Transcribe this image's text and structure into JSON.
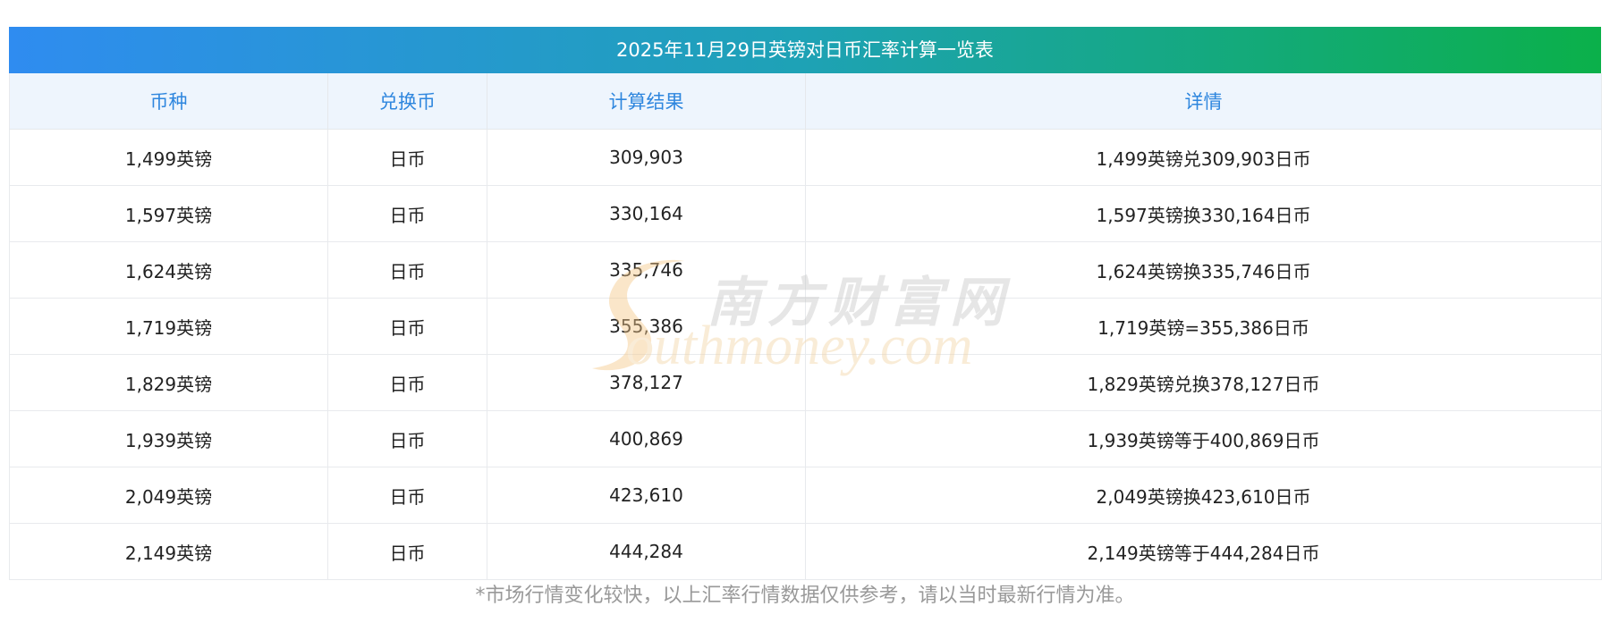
{
  "title": "2025年11月29日英镑对日币汇率计算一览表",
  "headers": [
    "币种",
    "兑换币",
    "计算结果",
    "详情"
  ],
  "rows": [
    [
      "1,499英镑",
      "日币",
      "309,903",
      "1,499英镑兑309,903日币"
    ],
    [
      "1,597英镑",
      "日币",
      "330,164",
      "1,597英镑换330,164日币"
    ],
    [
      "1,624英镑",
      "日币",
      "335,746",
      "1,624英镑换335,746日币"
    ],
    [
      "1,719英镑",
      "日币",
      "355,386",
      "1,719英镑=355,386日币"
    ],
    [
      "1,829英镑",
      "日币",
      "378,127",
      "1,829英镑兑换378,127日币"
    ],
    [
      "1,939英镑",
      "日币",
      "400,869",
      "1,939英镑等于400,869日币"
    ],
    [
      "2,049英镑",
      "日币",
      "423,610",
      "2,049英镑换423,610日币"
    ],
    [
      "2,149英镑",
      "日币",
      "444,284",
      "2,149英镑等于444,284日币"
    ]
  ],
  "note": "*市场行情变化较快，以上汇率行情数据仅供参考，请以当时最新行情为准。",
  "watermark": {
    "cn": "南方财富网",
    "en": "outhmoney.com"
  },
  "colors": {
    "title_gradient_start": "#2f8cf0",
    "title_gradient_end": "#0bb04a",
    "header_text": "#2e86de",
    "header_bg": "#eef5fd"
  }
}
